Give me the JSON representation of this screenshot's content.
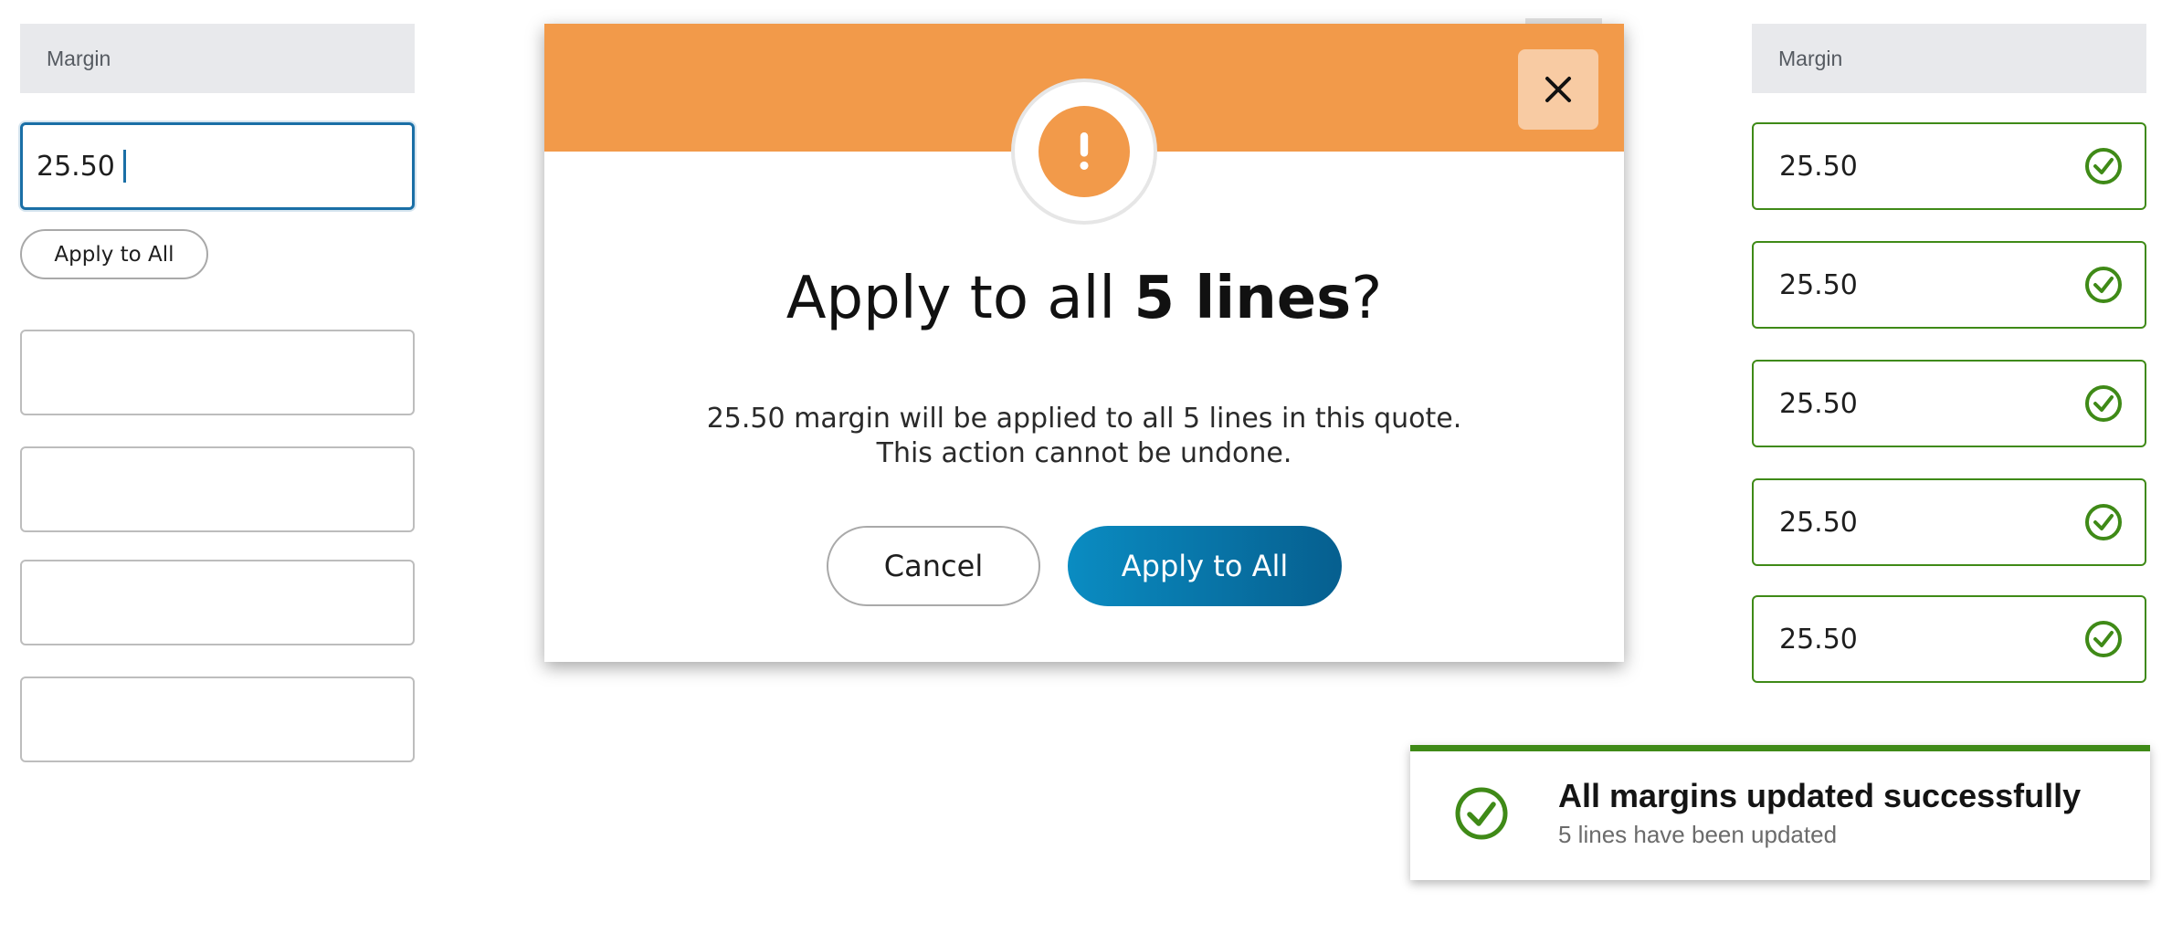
{
  "left_panel": {
    "header": "Margin",
    "input_value": "25.50",
    "apply_button": "Apply to All",
    "empty_rows": [
      "",
      "",
      "",
      ""
    ]
  },
  "modal": {
    "icon": "exclamation-icon",
    "close_icon": "close-icon",
    "title_prefix": "Apply to all ",
    "title_bold": "5 lines",
    "title_suffix": "?",
    "body_line1": "25.50 margin will be applied to all 5 lines in this quote.",
    "body_line2": "This action cannot be undone.",
    "cancel_label": "Cancel",
    "apply_label": "Apply to All",
    "header_color": "#f29a4a"
  },
  "right_panel": {
    "header": "Margin",
    "rows": [
      {
        "value": "25.50",
        "status_icon": "check-circle-icon"
      },
      {
        "value": "25.50",
        "status_icon": "check-circle-icon"
      },
      {
        "value": "25.50",
        "status_icon": "check-circle-icon"
      },
      {
        "value": "25.50",
        "status_icon": "check-circle-icon"
      },
      {
        "value": "25.50",
        "status_icon": "check-circle-icon"
      }
    ]
  },
  "toast": {
    "icon": "check-circle-icon",
    "title": "All margins updated successfully",
    "subtitle": "5 lines have been updated",
    "accent_color": "#3f8a17"
  }
}
